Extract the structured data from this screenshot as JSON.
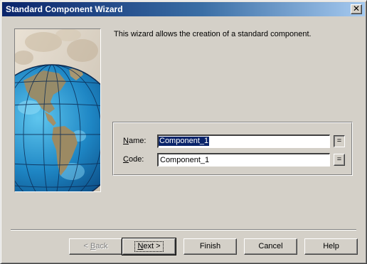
{
  "window": {
    "title": "Standard Component Wizard",
    "close_glyph": "✕"
  },
  "intro_text": "This wizard allows the creation of a standard component.",
  "form": {
    "name_label_key": "N",
    "name_label_rest": "ame:",
    "name_value": "Component_1",
    "code_label_key": "C",
    "code_label_rest": "ode:",
    "code_value": "Component_1",
    "equals_glyph": "="
  },
  "buttons": {
    "back_key": "B",
    "back_prefix": "< ",
    "back_suffix": "ack",
    "next_key": "N",
    "next_suffix": "ext >",
    "finish": "Finish",
    "cancel": "Cancel",
    "help": "Help"
  },
  "colors": {
    "face": "#d4d0c8",
    "title_start": "#0a246a",
    "title_end": "#a6caf0",
    "selection": "#0a246a"
  },
  "icons": {
    "side_image": "globe-illustration",
    "close": "close-icon"
  }
}
